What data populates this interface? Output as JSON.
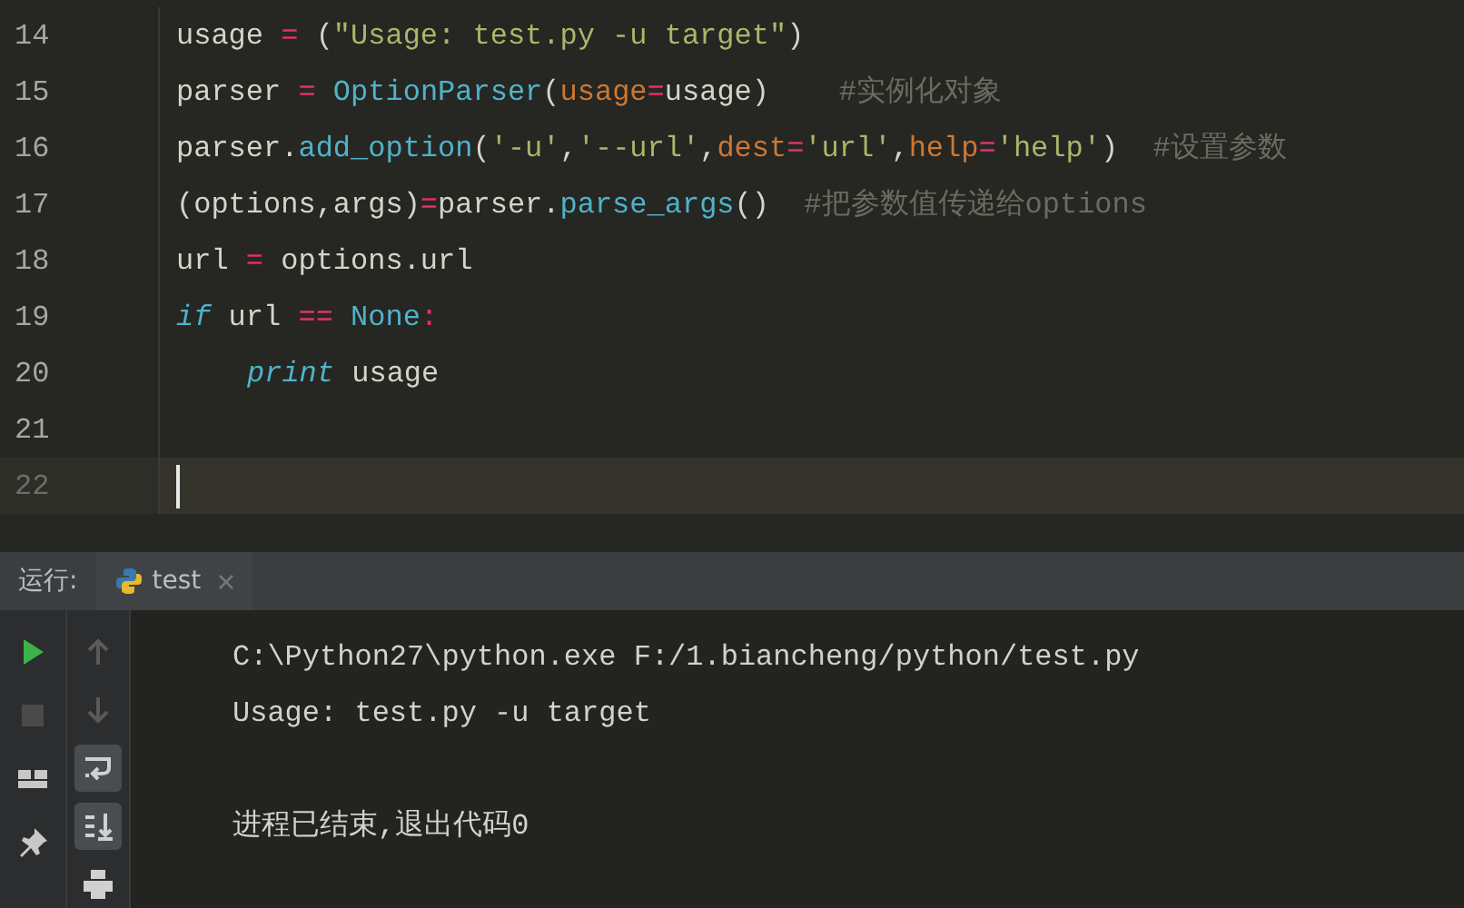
{
  "editor": {
    "lines": [
      {
        "number": "14",
        "current": false,
        "indented": false,
        "tokens": [
          {
            "kind": "plain",
            "text": "usage "
          },
          {
            "kind": "op",
            "text": "="
          },
          {
            "kind": "plain",
            "text": " ("
          },
          {
            "kind": "string",
            "text": "\"Usage: test.py -u target\""
          },
          {
            "kind": "plain",
            "text": ")"
          }
        ]
      },
      {
        "number": "15",
        "current": false,
        "indented": false,
        "tokens": [
          {
            "kind": "plain",
            "text": "parser "
          },
          {
            "kind": "op",
            "text": "="
          },
          {
            "kind": "func",
            "text": " OptionParser"
          },
          {
            "kind": "plain",
            "text": "("
          },
          {
            "kind": "param",
            "text": "usage"
          },
          {
            "kind": "op",
            "text": "="
          },
          {
            "kind": "plain",
            "text": "usage)    "
          },
          {
            "kind": "comment",
            "text": "#实例化对象"
          }
        ]
      },
      {
        "number": "16",
        "current": false,
        "indented": false,
        "tokens": [
          {
            "kind": "plain",
            "text": "parser."
          },
          {
            "kind": "func",
            "text": "add_option"
          },
          {
            "kind": "plain",
            "text": "("
          },
          {
            "kind": "string",
            "text": "'-u'"
          },
          {
            "kind": "plain",
            "text": ","
          },
          {
            "kind": "string",
            "text": "'--url'"
          },
          {
            "kind": "plain",
            "text": ","
          },
          {
            "kind": "param",
            "text": "dest"
          },
          {
            "kind": "op",
            "text": "="
          },
          {
            "kind": "string",
            "text": "'url'"
          },
          {
            "kind": "plain",
            "text": ","
          },
          {
            "kind": "param",
            "text": "help"
          },
          {
            "kind": "op",
            "text": "="
          },
          {
            "kind": "string",
            "text": "'help'"
          },
          {
            "kind": "plain",
            "text": ")  "
          },
          {
            "kind": "comment",
            "text": "#设置参数"
          }
        ]
      },
      {
        "number": "17",
        "current": false,
        "indented": false,
        "tokens": [
          {
            "kind": "plain",
            "text": "(options,args)"
          },
          {
            "kind": "op",
            "text": "="
          },
          {
            "kind": "plain",
            "text": "parser."
          },
          {
            "kind": "func",
            "text": "parse_args"
          },
          {
            "kind": "plain",
            "text": "()  "
          },
          {
            "kind": "comment",
            "text": "#把参数值传递给options"
          }
        ]
      },
      {
        "number": "18",
        "current": false,
        "indented": false,
        "tokens": [
          {
            "kind": "plain",
            "text": "url "
          },
          {
            "kind": "op",
            "text": "="
          },
          {
            "kind": "plain",
            "text": " options.url"
          }
        ]
      },
      {
        "number": "19",
        "current": false,
        "indented": false,
        "tokens": [
          {
            "kind": "keyword",
            "text": "if"
          },
          {
            "kind": "plain",
            "text": " url "
          },
          {
            "kind": "op",
            "text": "=="
          },
          {
            "kind": "func",
            "text": " None"
          },
          {
            "kind": "op",
            "text": ":"
          }
        ]
      },
      {
        "number": "20",
        "current": false,
        "indented": true,
        "tokens": [
          {
            "kind": "keyword",
            "text": "print"
          },
          {
            "kind": "plain",
            "text": " usage"
          }
        ]
      },
      {
        "number": "21",
        "current": false
      },
      {
        "number": "22",
        "current": true
      }
    ]
  },
  "run_panel": {
    "label": "运行:",
    "tab": {
      "title": "test"
    },
    "toolbar_left": [
      {
        "kind": "run",
        "disabled": false
      },
      {
        "kind": "stop",
        "disabled": true
      },
      {
        "kind": "layout",
        "disabled": false
      },
      {
        "kind": "pin",
        "disabled": false
      }
    ],
    "toolbar_right": [
      {
        "kind": "up",
        "disabled": true,
        "on": false
      },
      {
        "kind": "down",
        "disabled": true,
        "on": false
      },
      {
        "kind": "wrap",
        "disabled": false,
        "on": true
      },
      {
        "kind": "scroll",
        "disabled": false,
        "on": true
      },
      {
        "kind": "print",
        "disabled": false,
        "on": false
      }
    ],
    "console": [
      {
        "text": "C:\\Python27\\python.exe F:/1.biancheng/python/test.py",
        "spaced": false
      },
      {
        "text": "Usage: test.py -u target",
        "spaced": false
      },
      {
        "text": "进程已结束,退出代码0",
        "spaced": true
      }
    ]
  }
}
